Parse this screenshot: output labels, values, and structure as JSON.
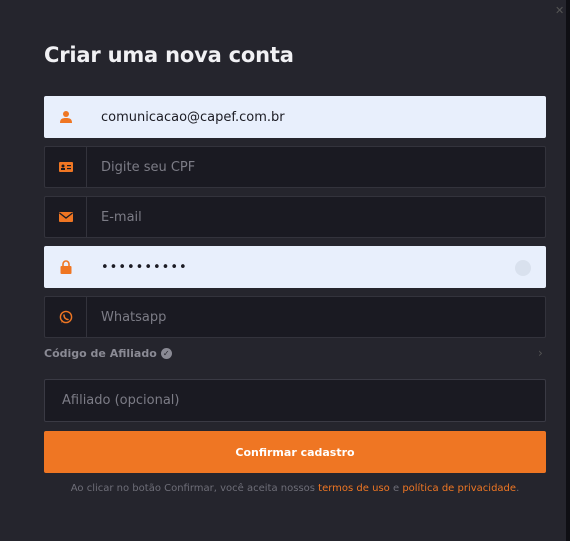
{
  "title": "Criar uma nova conta",
  "fields": {
    "email": {
      "value": "comunicacao@capef.com.br",
      "icon": "user-icon"
    },
    "cpf": {
      "placeholder": "Digite seu CPF",
      "icon": "id-card-icon"
    },
    "mail": {
      "placeholder": "E-mail",
      "icon": "envelope-icon"
    },
    "password": {
      "value": "••••••••••",
      "icon": "lock-icon"
    },
    "whatsapp": {
      "placeholder": "Whatsapp",
      "icon": "whatsapp-icon"
    }
  },
  "affiliate": {
    "label": "Código de Afiliado",
    "placeholder": "Afiliado (opcional)"
  },
  "submit_label": "Confirmar cadastro",
  "terms": {
    "prefix": "Ao clicar no botão Confirmar, você aceita nossos",
    "terms_link": "termos de uso",
    "and": "e",
    "privacy_link": "política de privacidade",
    "suffix": "."
  },
  "colors": {
    "accent": "#ef7623",
    "modal_bg": "#25252d",
    "input_bg": "#1a1a22",
    "filled_bg": "#e8effc"
  }
}
